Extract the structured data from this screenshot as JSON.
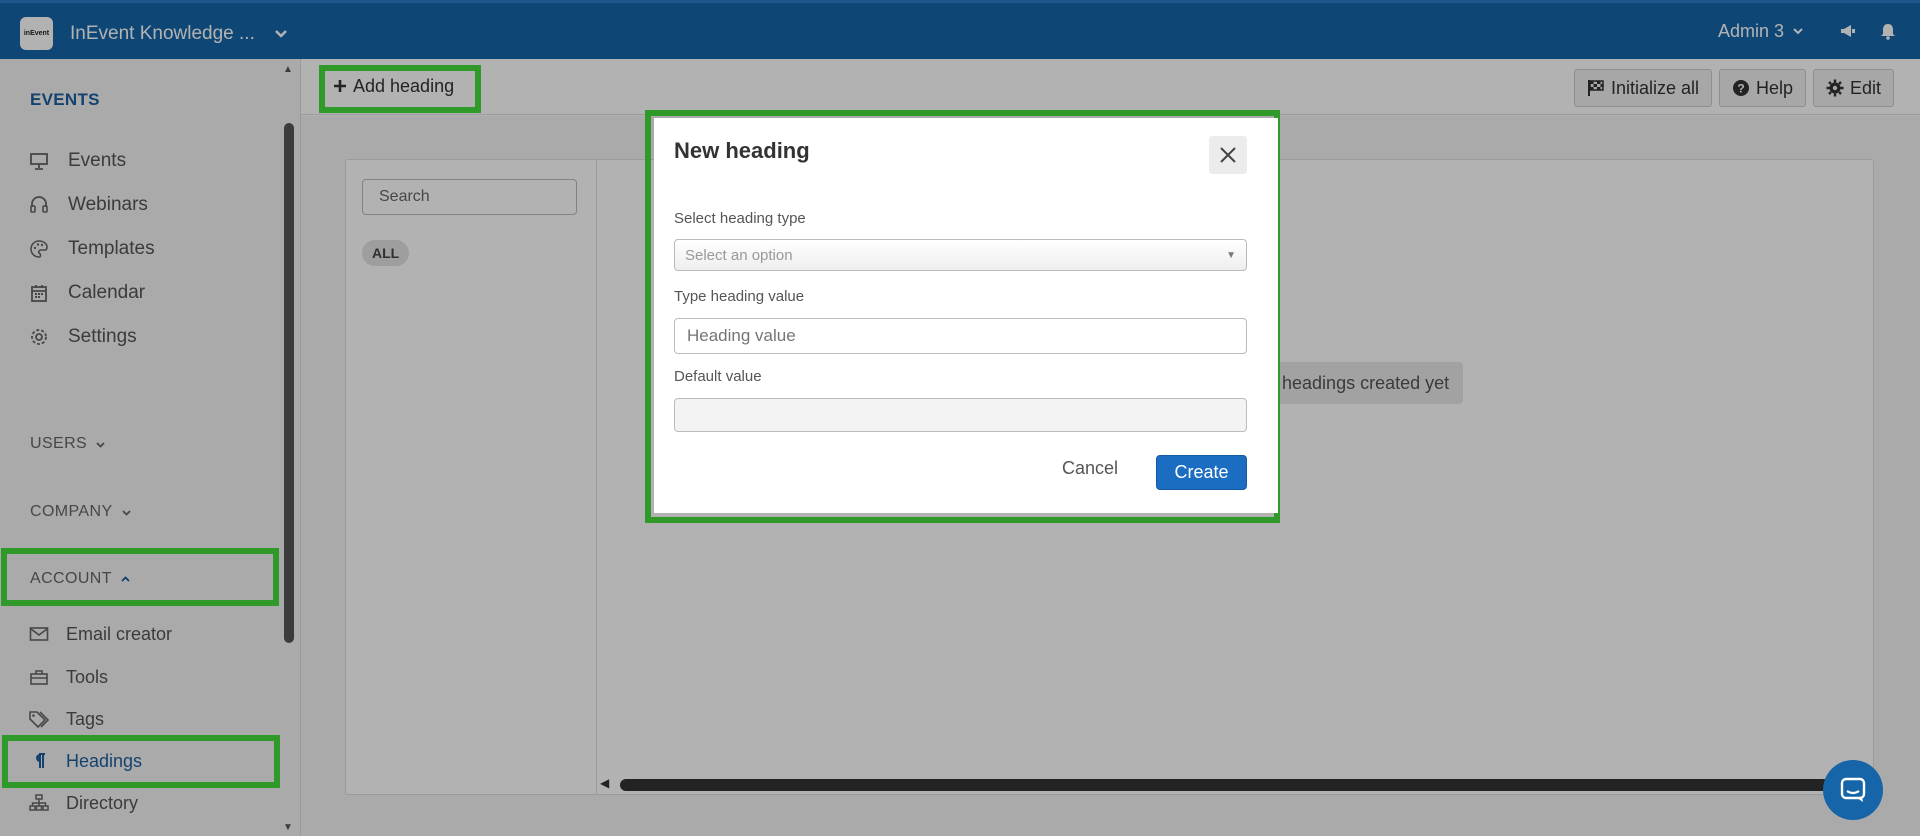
{
  "topbar": {
    "brand_logo_text": "inEvent",
    "app_name": "InEvent Knowledge ...",
    "user_name": "Admin 3",
    "colors": {
      "bar": "#1565a8",
      "highlight": "#2f9a2a",
      "primary_button": "#1b6dc1"
    }
  },
  "sidebar": {
    "events_title": "EVENTS",
    "events_items": [
      {
        "label": "Events",
        "icon": "presentation-board-icon"
      },
      {
        "label": "Webinars",
        "icon": "headset-icon"
      },
      {
        "label": "Templates",
        "icon": "palette-icon"
      },
      {
        "label": "Calendar",
        "icon": "calendar-icon"
      },
      {
        "label": "Settings",
        "icon": "gear-icon"
      }
    ],
    "users_label": "USERS",
    "company_label": "COMPANY",
    "account_label": "ACCOUNT",
    "account_items": [
      {
        "label": "Email creator",
        "icon": "envelope-icon"
      },
      {
        "label": "Tools",
        "icon": "toolbox-icon"
      },
      {
        "label": "Tags",
        "icon": "tags-icon"
      },
      {
        "label": "Headings",
        "icon": "paragraph-icon"
      },
      {
        "label": "Directory",
        "icon": "sitemap-icon"
      }
    ]
  },
  "toolbar": {
    "add_heading": "Add heading",
    "initialize_all": "Initialize all",
    "help": "Help",
    "edit": "Edit"
  },
  "content": {
    "search_placeholder": "Search",
    "filter_all": "ALL",
    "empty_message": "No headings created yet"
  },
  "modal": {
    "title": "New heading",
    "select_label": "Select heading type",
    "select_placeholder": "Select an option",
    "value_label": "Type heading value",
    "value_placeholder": "Heading value",
    "default_label": "Default value",
    "default_value": "",
    "cancel": "Cancel",
    "create": "Create"
  }
}
